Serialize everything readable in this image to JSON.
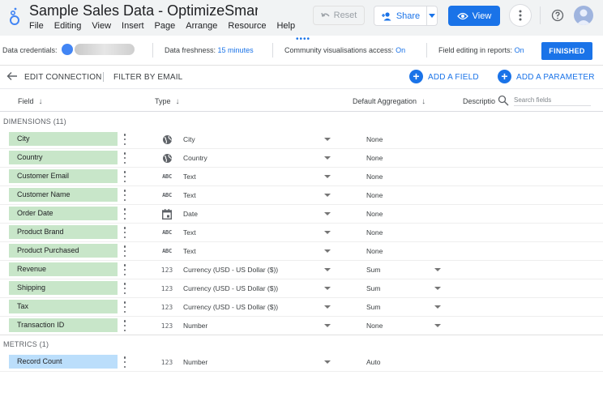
{
  "app": {
    "doc_title": "Sample Sales Data - OptimizeSmart.com",
    "menu": [
      "File",
      "Editing",
      "View",
      "Insert",
      "Page",
      "Arrange",
      "Resource",
      "Help"
    ],
    "reset_label": "Reset",
    "share_label": "Share",
    "view_label": "View"
  },
  "infobar": {
    "credentials_label": "Data credentials:",
    "freshness_label": "Data freshness:",
    "freshness_value": "15 minutes",
    "community_label": "Community visualisations access:",
    "community_value": "On",
    "field_editing_label": "Field editing in reports:",
    "field_editing_value": "On",
    "finished_label": "FINISHED"
  },
  "toolbar": {
    "edit_connection": "EDIT CONNECTION",
    "filter_by_email": "FILTER BY EMAIL",
    "add_field": "ADD A FIELD",
    "add_parameter": "ADD A PARAMETER"
  },
  "columns": {
    "field": "Field",
    "type": "Type",
    "default_aggregation": "Default Aggregation",
    "description": "Descriptio",
    "search_placeholder": "Search fields"
  },
  "dimensions": {
    "label": "DIMENSIONS (11)",
    "fields": [
      {
        "name": "City",
        "type_icon": "globe-icon",
        "type": "City",
        "aggregation": "None",
        "agg_dropdown": false
      },
      {
        "name": "Country",
        "type_icon": "globe-icon",
        "type": "Country",
        "aggregation": "None",
        "agg_dropdown": false
      },
      {
        "name": "Customer Email",
        "type_icon": "text-type-icon",
        "type": "Text",
        "aggregation": "None",
        "agg_dropdown": false
      },
      {
        "name": "Customer Name",
        "type_icon": "text-type-icon",
        "type": "Text",
        "aggregation": "None",
        "agg_dropdown": false
      },
      {
        "name": "Order Date",
        "type_icon": "calendar-icon",
        "type": "Date",
        "aggregation": "None",
        "agg_dropdown": false
      },
      {
        "name": "Product Brand",
        "type_icon": "text-type-icon",
        "type": "Text",
        "aggregation": "None",
        "agg_dropdown": false
      },
      {
        "name": "Product Purchased",
        "type_icon": "text-type-icon",
        "type": "Text",
        "aggregation": "None",
        "agg_dropdown": false
      },
      {
        "name": "Revenue",
        "type_icon": "number-type-icon",
        "type": "Currency (USD - US Dollar ($))",
        "aggregation": "Sum",
        "agg_dropdown": true
      },
      {
        "name": "Shipping",
        "type_icon": "number-type-icon",
        "type": "Currency (USD - US Dollar ($))",
        "aggregation": "Sum",
        "agg_dropdown": true
      },
      {
        "name": "Tax",
        "type_icon": "number-type-icon",
        "type": "Currency (USD - US Dollar ($))",
        "aggregation": "Sum",
        "agg_dropdown": true
      },
      {
        "name": "Transaction ID",
        "type_icon": "number-type-icon",
        "type": "Number",
        "aggregation": "None",
        "agg_dropdown": true
      }
    ]
  },
  "metrics": {
    "label": "METRICS (1)",
    "fields": [
      {
        "name": "Record Count",
        "type_icon": "number-type-icon",
        "type": "Number",
        "aggregation": "Auto",
        "agg_dropdown": false
      }
    ]
  },
  "icons": {
    "text_glyph": "ABC",
    "number_glyph": "123"
  },
  "colors": {
    "accent": "#1a73e8",
    "dimension_chip": "#c8e6c9",
    "metric_chip": "#bbdefb"
  }
}
